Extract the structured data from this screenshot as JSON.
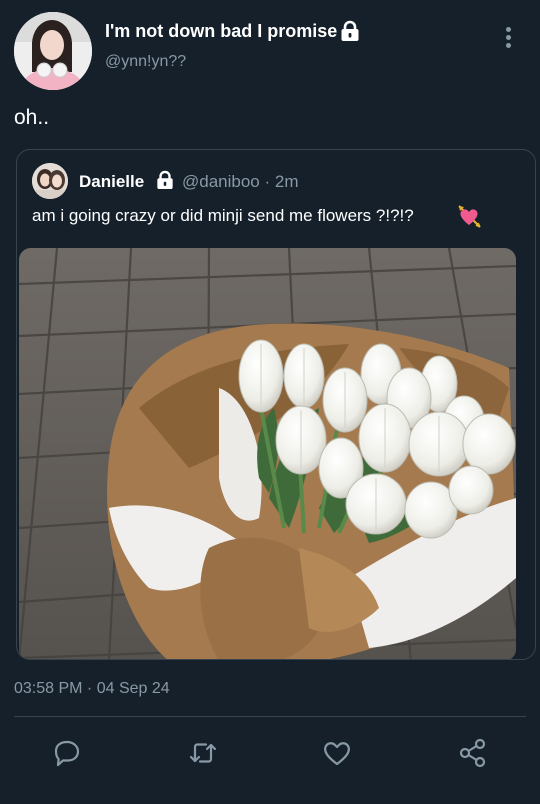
{
  "author": {
    "display_name": "I'm not down bad I promise",
    "handle": "@ynn!yn??",
    "protected": true,
    "avatar": "profile-photo-woman-pink-top-headphones"
  },
  "tweet": {
    "text": "oh..",
    "timestamp": "03:58 PM · 04 Sep 24"
  },
  "quoted": {
    "display_name": "Danielle",
    "protected": true,
    "handle": "@daniboo",
    "time": "2m",
    "text": "am i going crazy or did minji send me flowers ?!?!?",
    "emoji": "heart-with-arrow",
    "image": "white-tulip-bouquet-in-kraft-paper-on-tiled-floor"
  },
  "icons": {
    "more": "vertical-ellipsis-icon",
    "reply": "reply-bubble-icon",
    "retweet": "retweet-icon",
    "like": "heart-icon",
    "share": "share-icon",
    "lock": "lock-icon"
  },
  "colors": {
    "background": "#15202b",
    "secondary_text": "#8899a6",
    "border": "#38444d"
  }
}
